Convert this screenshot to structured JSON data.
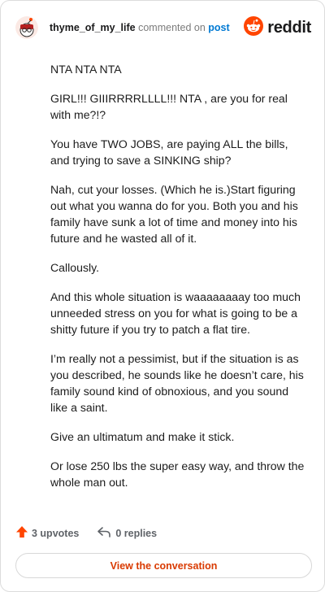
{
  "header": {
    "username": "thyme_of_my_life",
    "action": "commented on",
    "post_link": "post",
    "logo_text": "reddit"
  },
  "comment": {
    "paragraphs": [
      "NTA NTA NTA",
      "GIRL!!! GIIIRRRRLLLL!!! NTA , are you for real with me?!?",
      "You have TWO JOBS, are paying ALL the bills, and trying to save a SINKING ship?",
      "Nah, cut your losses. (Which he is.)Start figuring out what you wanna do for you. Both you and his family have sunk a lot of time and money into his future and he wasted all of it.",
      "Callously.",
      "And this whole situation is waaaaaaaay too much unneeded stress on you for what is going to be a shitty future if you try to patch a flat tire.",
      "I’m really not a pessimist, but if the situation is as you described, he sounds like he doesn’t care, his family sound kind of obnoxious, and you sound like a saint.",
      "Give an ultimatum and make it stick.",
      "Or lose 250 lbs the super easy way, and throw the whole man out."
    ]
  },
  "footer": {
    "upvotes": "3 upvotes",
    "replies": "0 replies",
    "view_button": "View the conversation"
  },
  "colors": {
    "accent": "#ff4500",
    "link": "#0079d3",
    "button_text": "#d93a00"
  },
  "icons": {
    "avatar": "snoo-avatar",
    "logo": "reddit-logo-icon",
    "upvote": "upvote-arrow-icon",
    "reply": "reply-arrow-icon"
  }
}
